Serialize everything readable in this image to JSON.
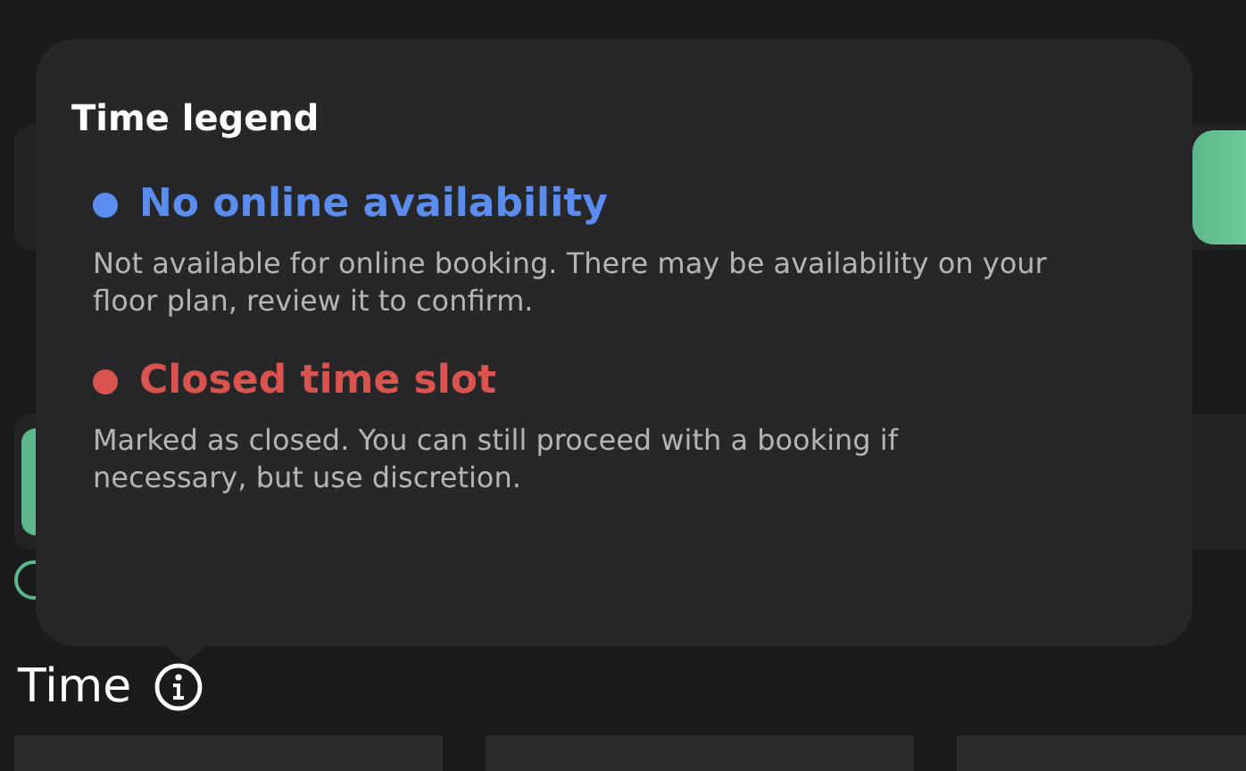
{
  "background": {
    "time_label": "Time"
  },
  "legend": {
    "title": "Time legend",
    "items": [
      {
        "label": "No online availability",
        "color": "#5b8def",
        "description": "Not available for online booking. There may be availability on your floor plan, review it to confirm."
      },
      {
        "label": "Closed time slot",
        "color": "#d9534f",
        "description": "Marked as closed. You can still proceed with a booking if necessary, but use discretion."
      }
    ]
  }
}
